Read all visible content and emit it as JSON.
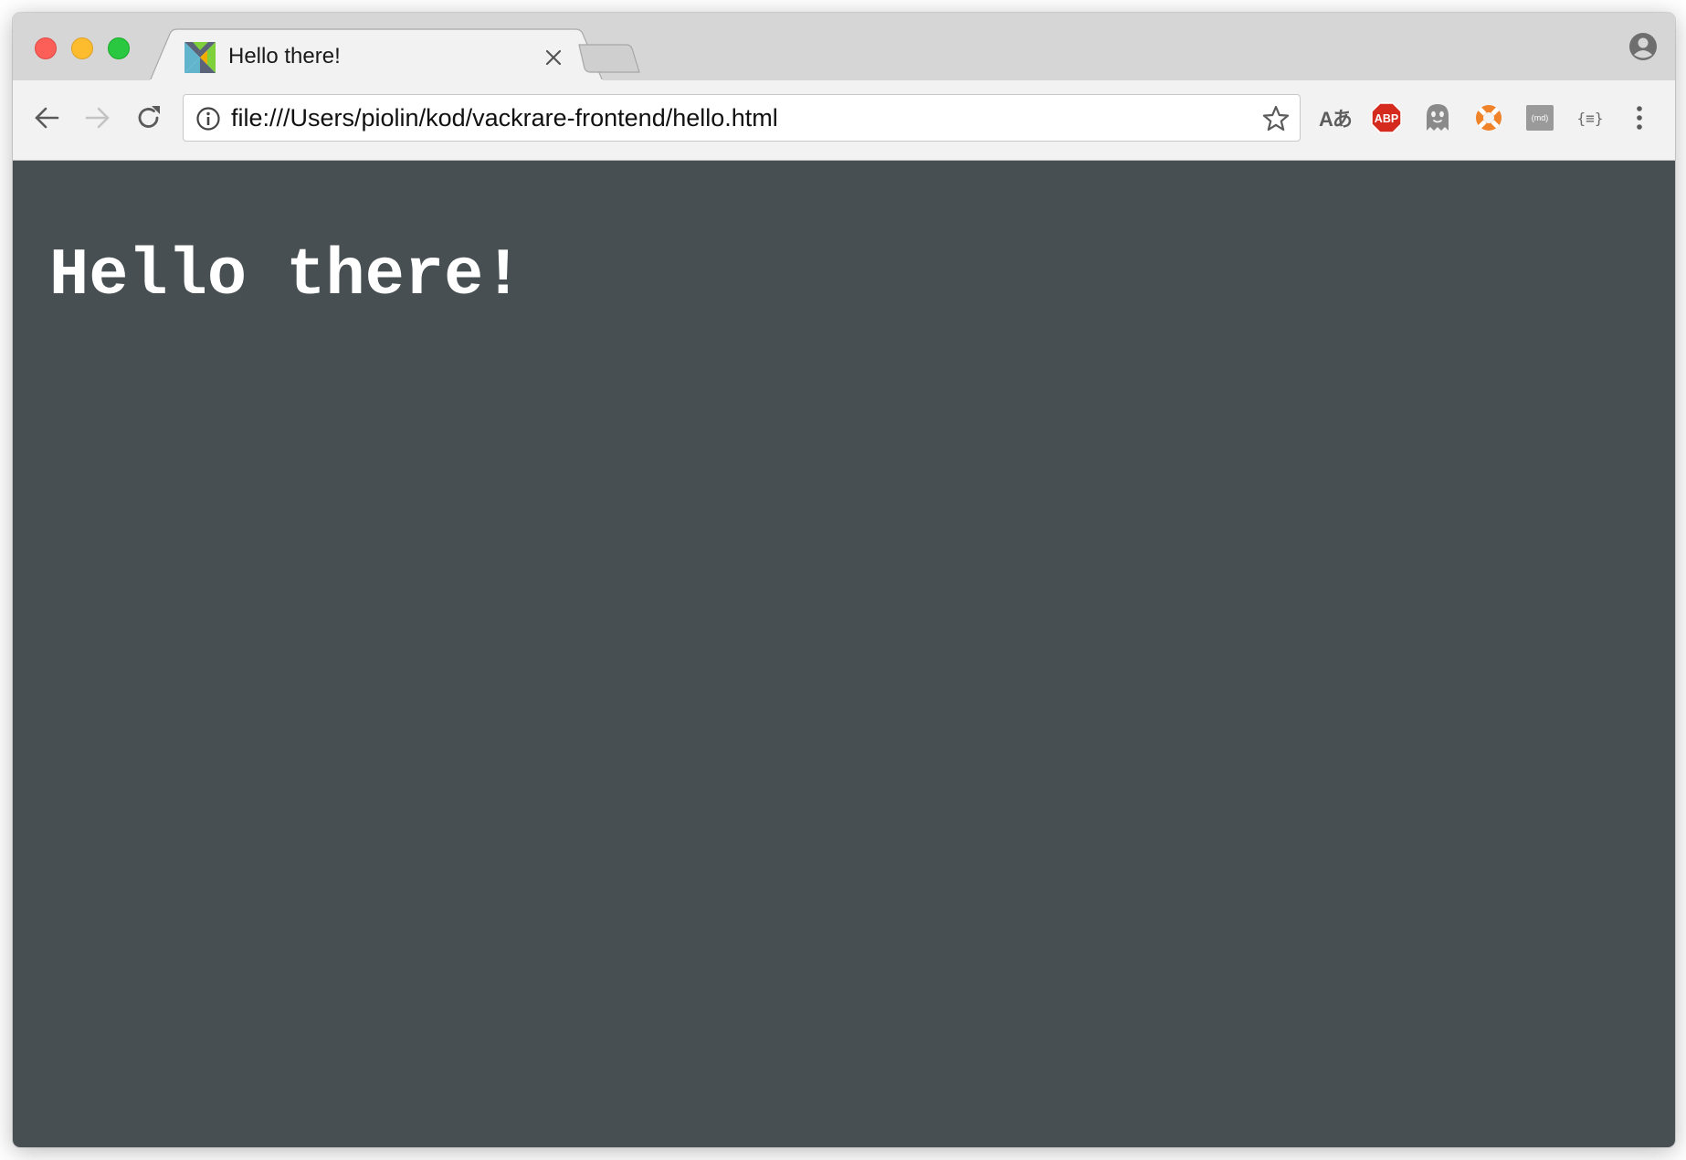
{
  "browser": {
    "tab": {
      "title": "Hello there!",
      "favicon": "elm-logo-icon"
    },
    "address_bar": {
      "url": "file:///Users/piolin/kod/vackrare-frontend/hello.html"
    },
    "extensions": [
      {
        "name": "translate-icon",
        "text": "Aあ"
      },
      {
        "name": "adblock-plus-icon",
        "text": "ABP"
      },
      {
        "name": "ghostery-icon",
        "text": ""
      },
      {
        "name": "lifebuoy-icon",
        "text": ""
      },
      {
        "name": "markdown-icon",
        "text": "(md)"
      },
      {
        "name": "json-formatter-icon",
        "text": "{≡}"
      }
    ],
    "colors": {
      "tab_strip": "#d6d6d6",
      "toolbar": "#f2f2f2",
      "page_background": "#474f52",
      "heading_text": "#ffffff"
    }
  },
  "page": {
    "heading": "Hello there!"
  }
}
